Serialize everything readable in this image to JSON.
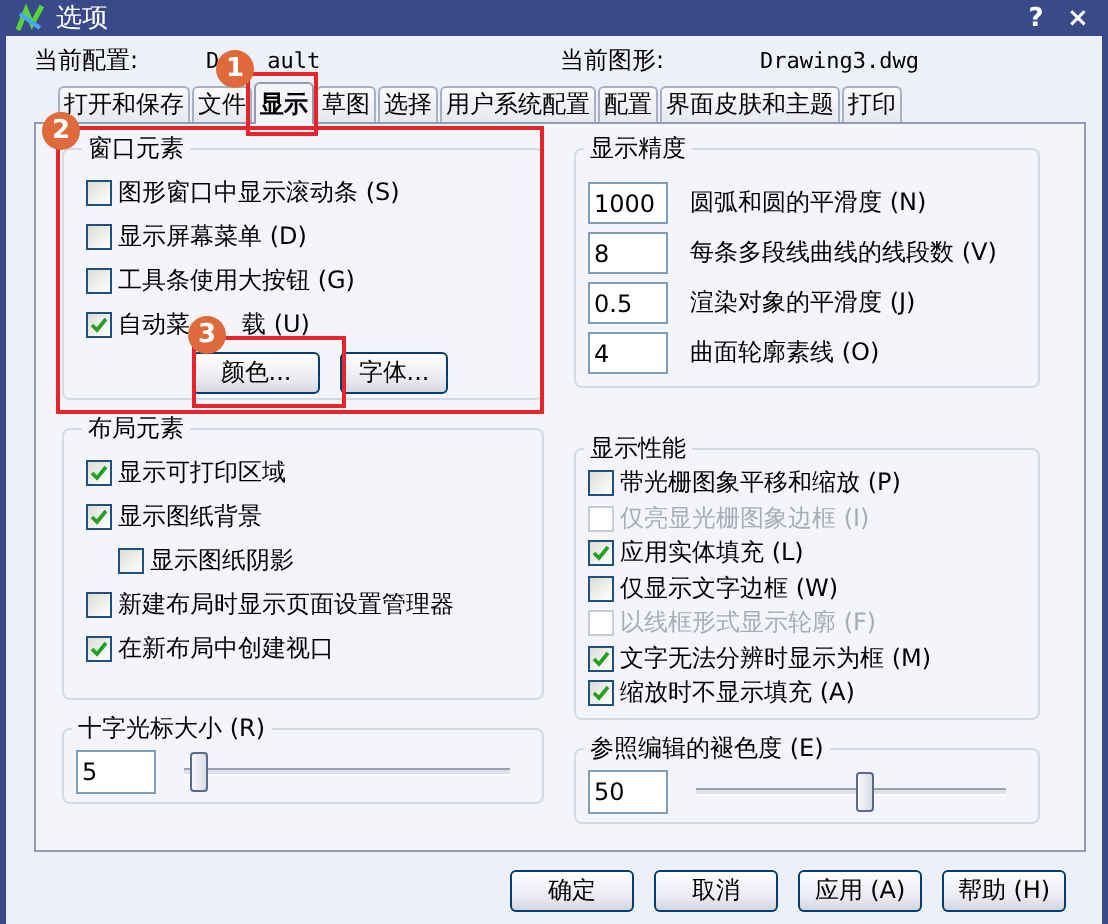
{
  "window": {
    "title": "选项",
    "help": "?",
    "close": "×"
  },
  "profile": {
    "label": "当前配置:",
    "value_parts": [
      "D",
      "ault"
    ]
  },
  "drawing": {
    "label": "当前图形:",
    "value": "Drawing3.dwg"
  },
  "tabs": [
    {
      "label": "打开和保存",
      "selected": false
    },
    {
      "label": "文件",
      "selected": false
    },
    {
      "label": "显示",
      "selected": true
    },
    {
      "label": "草图",
      "selected": false
    },
    {
      "label": "选择",
      "selected": false
    },
    {
      "label": "用户系统配置",
      "selected": false
    },
    {
      "label": "配置",
      "selected": false
    },
    {
      "label": "界面皮肤和主题",
      "selected": false
    },
    {
      "label": "打印",
      "selected": false
    }
  ],
  "window_elements": {
    "title": "窗口元素",
    "checkboxes": [
      {
        "label_parts": [
          "图形窗口中显示滚动条 (S)"
        ],
        "checked": false,
        "disabled": false
      },
      {
        "label_parts": [
          "显示屏幕菜单 (D)"
        ],
        "checked": false,
        "disabled": false
      },
      {
        "label_parts": [
          "工具条使用大按钮 (G)"
        ],
        "checked": false,
        "disabled": false
      },
      {
        "label_parts": [
          "自动菜",
          "载 (U)"
        ],
        "checked": true,
        "disabled": false
      }
    ],
    "buttons": [
      "颜色...",
      "字体..."
    ]
  },
  "layout_elements": {
    "title": "布局元素",
    "checkboxes": [
      {
        "label": "显示可打印区域",
        "checked": true
      },
      {
        "label": "显示图纸背景",
        "checked": true,
        "children": [
          {
            "label": "显示图纸阴影",
            "checked": false
          }
        ]
      },
      {
        "label": "新建布局时显示页面设置管理器",
        "checked": false
      },
      {
        "label": "在新布局中创建视口",
        "checked": true
      }
    ]
  },
  "crosshair_size": {
    "title": "十字光标大小 (R)",
    "value": "5",
    "level": 0.05
  },
  "display_resolution": {
    "title": "显示精度",
    "rows": [
      {
        "value": "1000",
        "label": "圆弧和圆的平滑度 (N)"
      },
      {
        "value": "8",
        "label": "每条多段线曲线的线段数 (V)"
      },
      {
        "value": "0.5",
        "label": "渲染对象的平滑度 (J)"
      },
      {
        "value": "4",
        "label": "曲面轮廓素线 (O)"
      }
    ]
  },
  "display_performance": {
    "title": "显示性能",
    "checkboxes": [
      {
        "label": "带光栅图象平移和缩放 (P)",
        "checked": false,
        "disabled": false
      },
      {
        "label": "仅亮显光栅图象边框 (I)",
        "checked": false,
        "disabled": true
      },
      {
        "label": "应用实体填充 (L)",
        "checked": true,
        "disabled": false
      },
      {
        "label": "仅显示文字边框 (W)",
        "checked": false,
        "disabled": false
      },
      {
        "label": "以线框形式显示轮廓 (F)",
        "checked": false,
        "disabled": true
      },
      {
        "label": "文字无法分辨时显示为框 (M)",
        "checked": true,
        "disabled": false
      },
      {
        "label": "缩放时不显示填充 (A)",
        "checked": true,
        "disabled": false
      }
    ]
  },
  "xref_fading": {
    "title": "参照编辑的褪色度 (E)",
    "value": "50",
    "level": 0.55
  },
  "buttons": [
    "确定",
    "取消",
    "应用 (A)",
    "帮助 (H)"
  ],
  "annotations": [
    {
      "number": "1"
    },
    {
      "number": "2"
    },
    {
      "number": "3"
    }
  ]
}
